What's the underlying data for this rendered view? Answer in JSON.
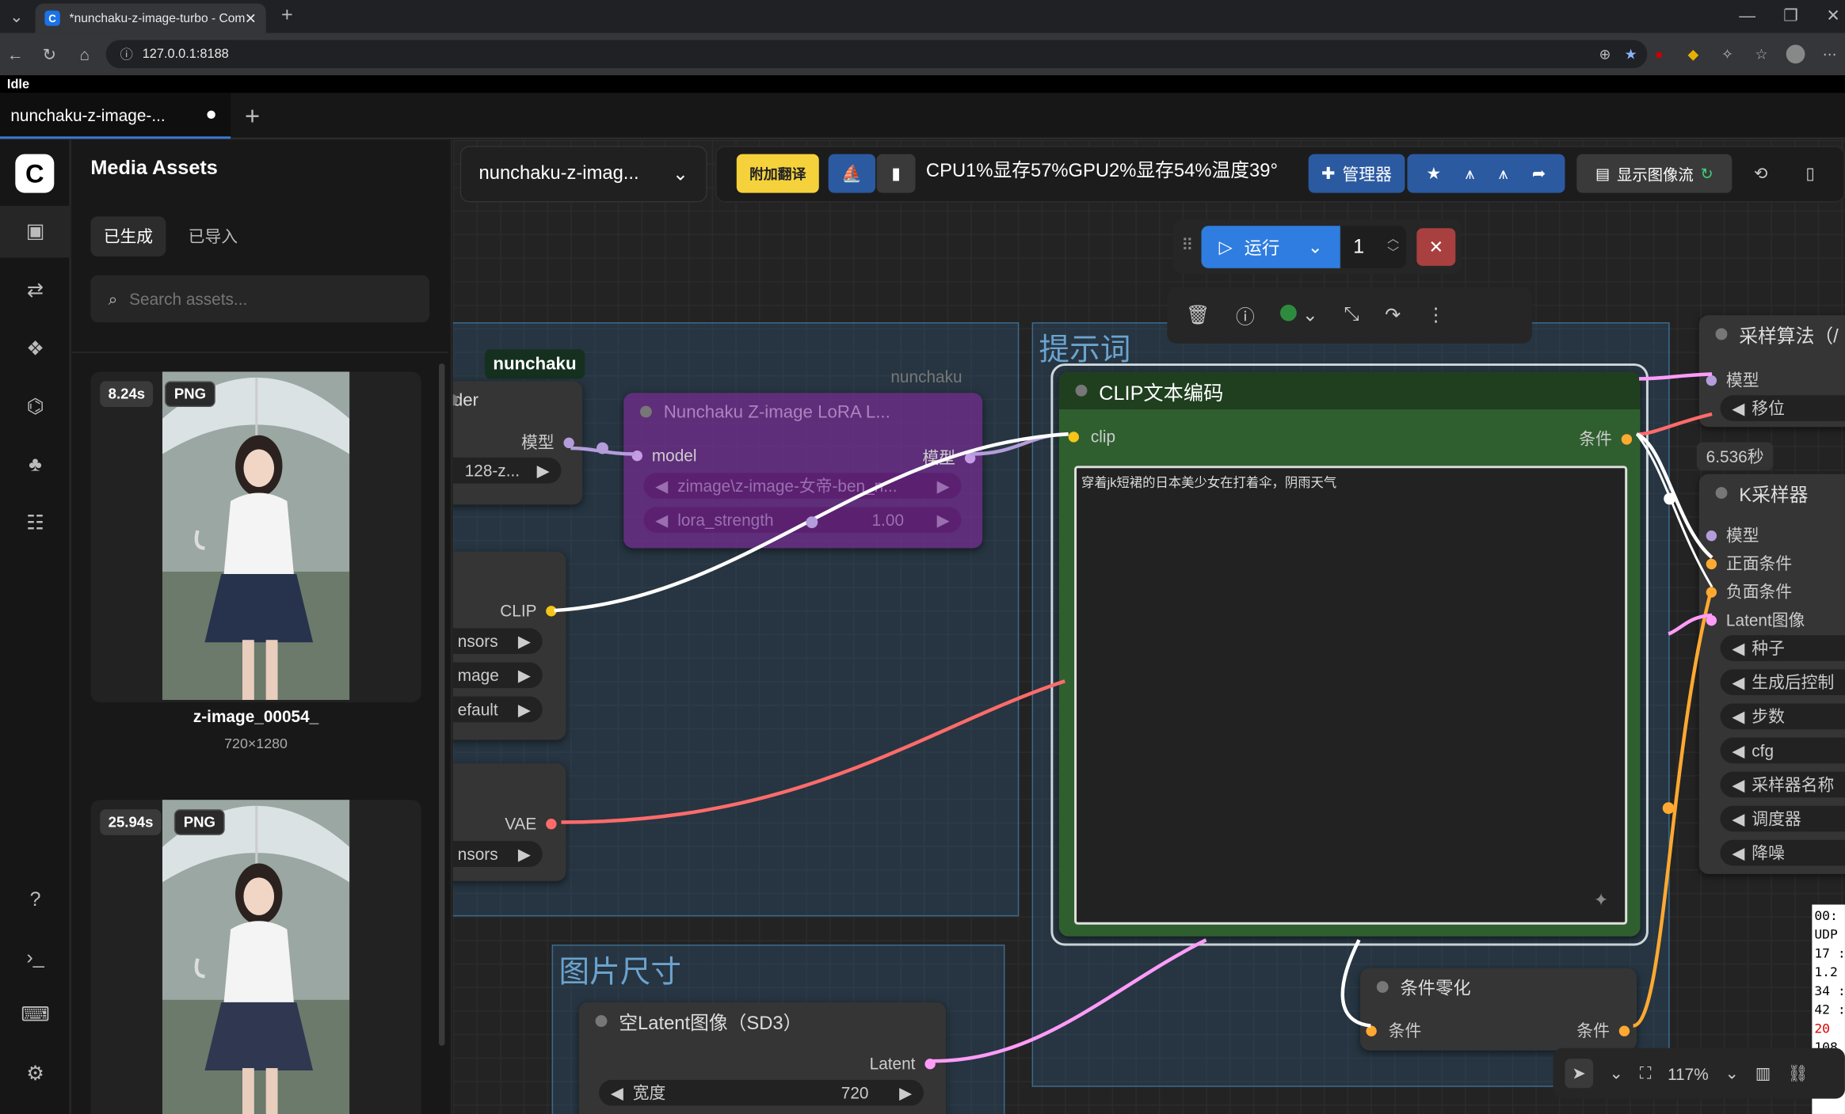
{
  "browser": {
    "tab_title": "*nunchaku-z-image-turbo - Comfy",
    "url": "127.0.0.1:8188"
  },
  "app": {
    "status": "Idle",
    "workflow_tab": "nunchaku-z-image-...",
    "workflow_name": "nunchaku-z-imag...",
    "toolbar": {
      "translate": "附加翻译",
      "stats": "CPU1%显存57%GPU2%显存54%温度39°",
      "manager": "管理器",
      "show_image_flow": "显示图像流"
    },
    "run": {
      "label": "运行",
      "count": "1"
    }
  },
  "assets": {
    "title": "Media Assets",
    "tabs": [
      "已生成",
      "已导入"
    ],
    "search_placeholder": "Search assets...",
    "items": [
      {
        "time": "8.24s",
        "format": "PNG",
        "name": "z-image_00054_",
        "size": "720×1280"
      },
      {
        "time": "25.94s",
        "format": "PNG"
      }
    ]
  },
  "canvas": {
    "groups": {
      "nunchaku": "nunchaku",
      "prompt": "提示词",
      "image_size": "图片尺寸"
    },
    "loader": {
      "title": "der",
      "out_model": "模型",
      "model_value": "128-z...",
      "out_clip": "CLIP",
      "w1": "nsors",
      "w2": "mage",
      "w3": "efault",
      "out_vae": "VAE",
      "w4": "nsors"
    },
    "lora": {
      "title": "Nunchaku Z-image LoRA L...",
      "in_model": "model",
      "out_model": "模型",
      "lora_name": "zimage\\z-image-女帝-ben_n...",
      "strength_label": "lora_strength",
      "strength_value": "1.00",
      "tag": "nunchaku"
    },
    "clip": {
      "title": "CLIP文本编码",
      "in": "clip",
      "out": "条件",
      "text": "穿着jk短裙的日本美少女在打着伞，阴雨天气"
    },
    "zero": {
      "title": "条件零化",
      "in": "条件",
      "out": "条件"
    },
    "latent": {
      "title": "空Latent图像（SD3）",
      "out": "Latent",
      "w_label": "宽度",
      "w_value": "720"
    },
    "sampler_algo": {
      "title": "采样算法（/",
      "in": "模型",
      "w": "移位"
    },
    "ksampler": {
      "title": "K采样器",
      "time": "6.536秒",
      "inputs": [
        "模型",
        "正面条件",
        "负面条件",
        "Latent图像"
      ],
      "widgets": [
        "种子",
        "生成后控制",
        "步数",
        "cfg",
        "采样器名称",
        "调度器",
        "降噪"
      ]
    },
    "zoom": "117%",
    "log": [
      "00:",
      "UDP",
      "17 :",
      "1.2",
      "34 :",
      "42 :",
      "20",
      "108"
    ]
  }
}
